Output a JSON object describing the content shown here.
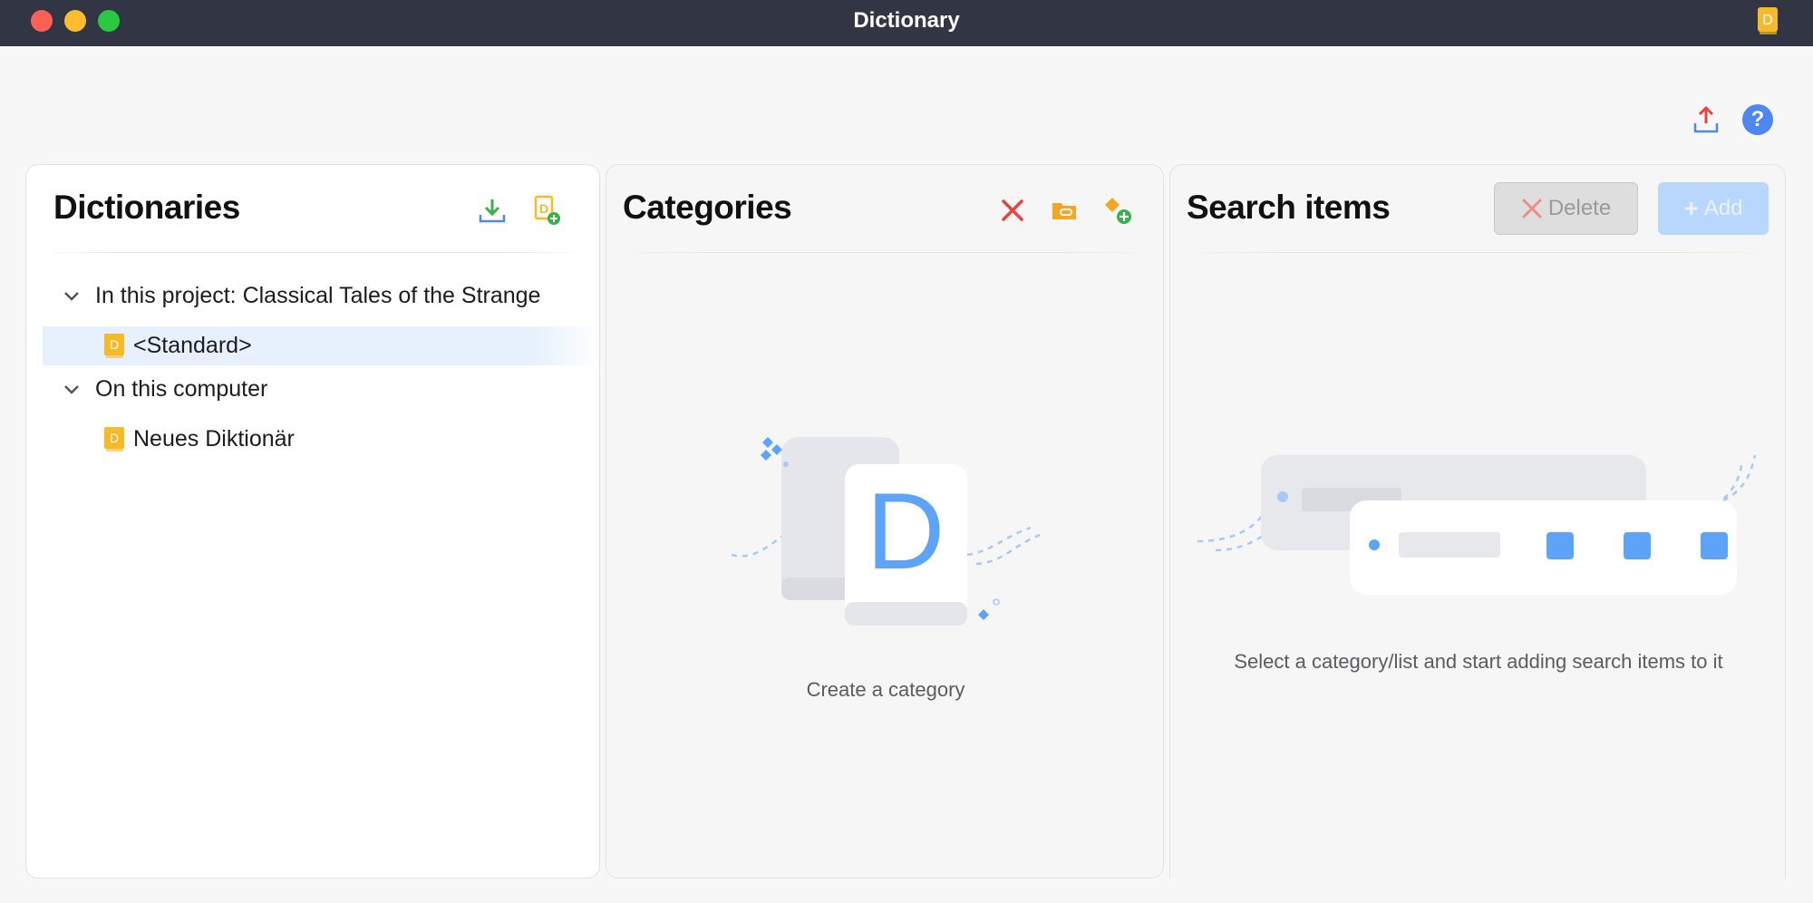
{
  "window": {
    "title": "Dictionary"
  },
  "toolbar": {
    "export_icon": "export-icon",
    "help_icon": "help-icon",
    "help_glyph": "?"
  },
  "dictionaries": {
    "title": "Dictionaries",
    "groups": [
      {
        "label": "In this project: Classical Tales of the Strange",
        "items": [
          "<Standard>"
        ]
      },
      {
        "label": "On this computer",
        "items": [
          "Neues Diktionär"
        ]
      }
    ],
    "selected_item": "<Standard>"
  },
  "categories": {
    "title": "Categories",
    "empty_text": "Create a category",
    "illustration_letter": "D"
  },
  "search_items": {
    "title": "Search items",
    "delete_label": "Delete",
    "add_label": "Add",
    "empty_text": "Select a category/list and start adding search items to it"
  },
  "colors": {
    "titlebar": "#313544",
    "accent_blue": "#5da3f8",
    "help_blue": "#4f87f2",
    "delete_red": "#e8433d",
    "download_green": "#3bb04a",
    "folder_orange": "#f5a524",
    "dict_yellow": "#f6b928"
  }
}
